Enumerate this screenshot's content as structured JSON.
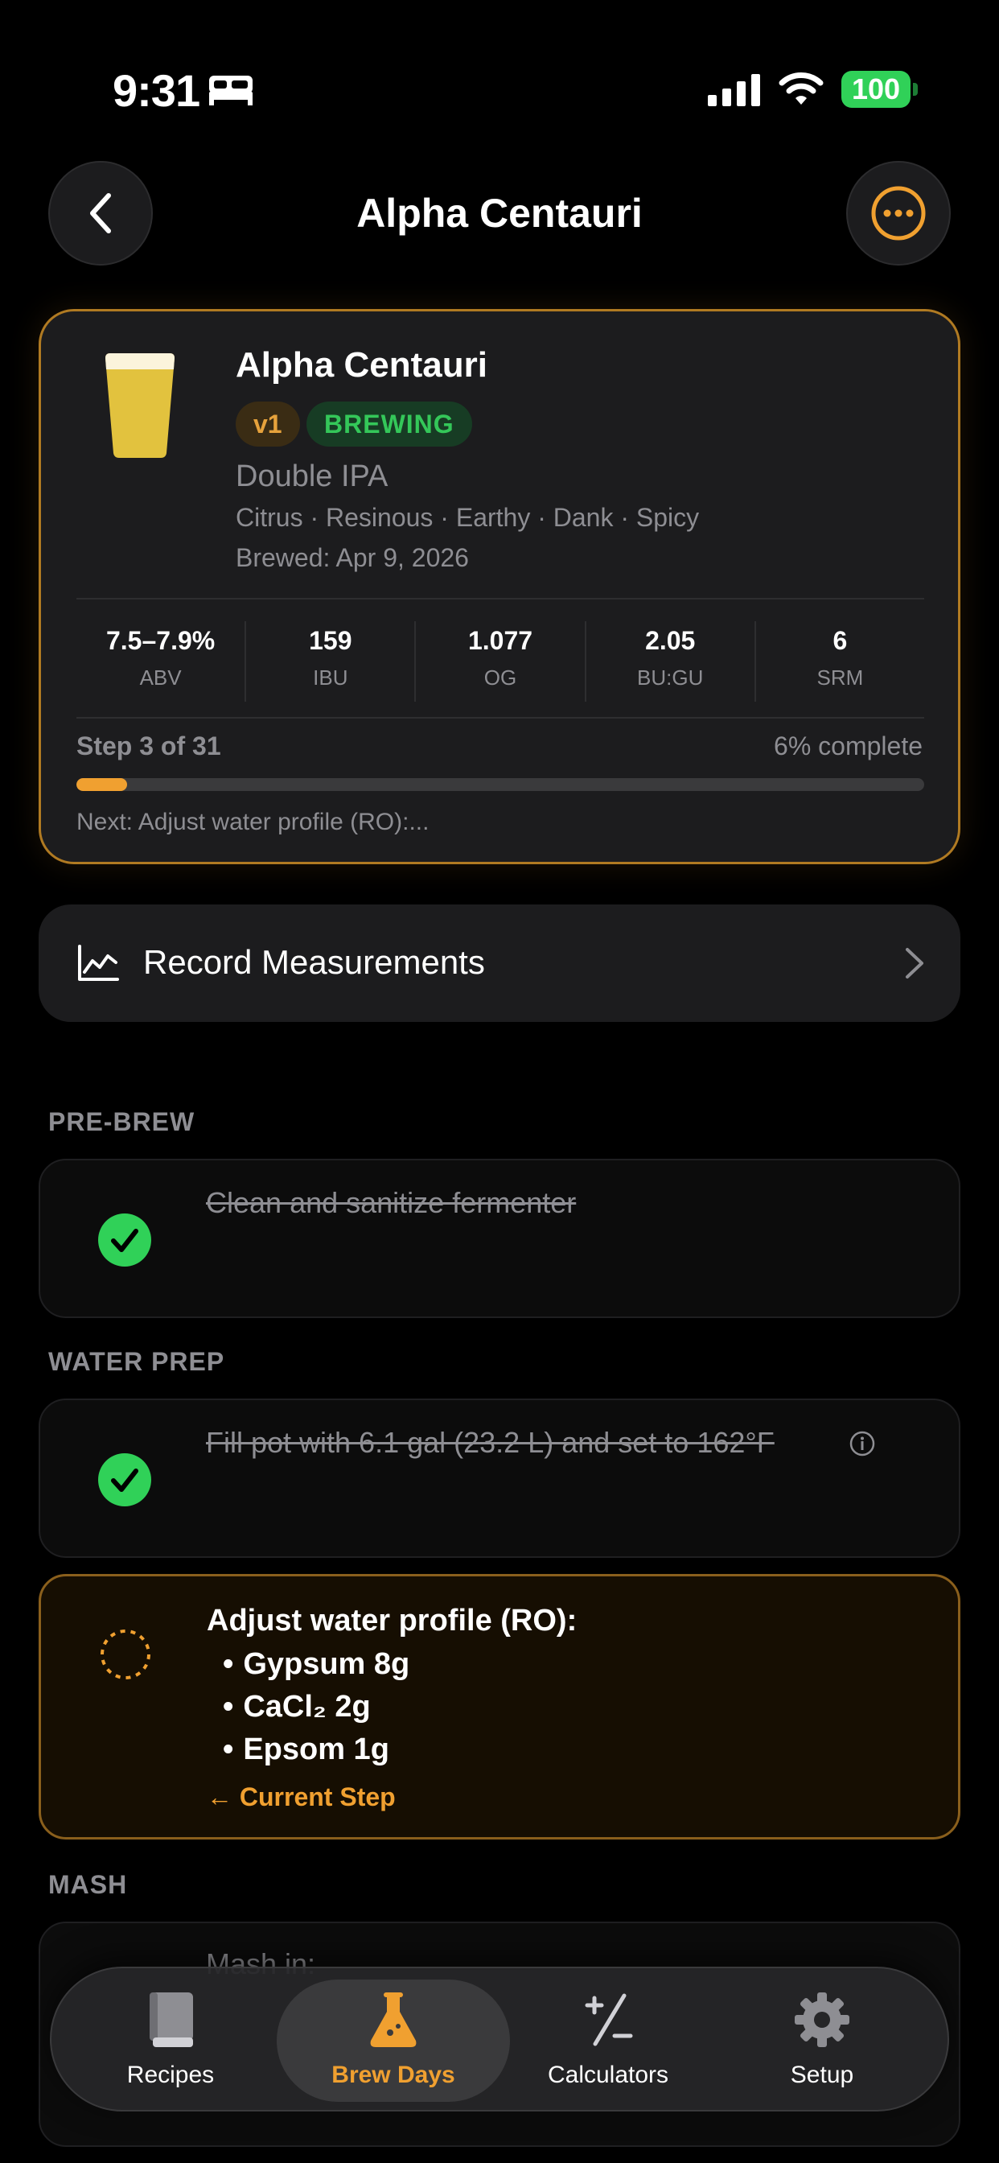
{
  "status_bar": {
    "time": "9:31",
    "battery": "100"
  },
  "nav": {
    "title": "Alpha Centauri"
  },
  "recipe": {
    "name": "Alpha Centauri",
    "version": "v1",
    "status": "BREWING",
    "style": "Double IPA",
    "flavors": "Citrus · Resinous · Earthy · Dank · Spicy",
    "brewed": "Brewed: Apr 9, 2026",
    "stats": [
      {
        "value": "7.5–7.9%",
        "label": "ABV"
      },
      {
        "value": "159",
        "label": "IBU"
      },
      {
        "value": "1.077",
        "label": "OG"
      },
      {
        "value": "2.05",
        "label": "BU:GU"
      },
      {
        "value": "6",
        "label": "SRM"
      }
    ],
    "step_label": "Step 3 of 31",
    "percent_label": "6% complete",
    "progress_fraction": 0.06,
    "next_label": "Next: Adjust water profile (RO):..."
  },
  "record": {
    "label": "Record Measurements"
  },
  "sections": {
    "pre_brew": "PRE-BREW",
    "water_prep": "WATER PREP",
    "mash": "MASH"
  },
  "steps": {
    "sanitize": "Clean and sanitize fermenter",
    "fill_pot": "Fill pot with 6.1 gal (23.2 L) and set to 162°F",
    "current_title": "Adjust water profile (RO):",
    "current_items": [
      "Gypsum 8g",
      "CaCl₂ 2g",
      "Epsom 1g"
    ],
    "current_link": "← Current Step",
    "mash_in": "Mash in:"
  },
  "tabs": [
    {
      "label": "Recipes",
      "icon": "book-icon"
    },
    {
      "label": "Brew Days",
      "icon": "flask-icon",
      "active": true
    },
    {
      "label": "Calculators",
      "icon": "plus-minus-icon"
    },
    {
      "label": "Setup",
      "icon": "gear-icon"
    }
  ],
  "colors": {
    "accent": "#f0a030",
    "success": "#34c759",
    "background": "#000000",
    "card": "#1c1c1e"
  }
}
